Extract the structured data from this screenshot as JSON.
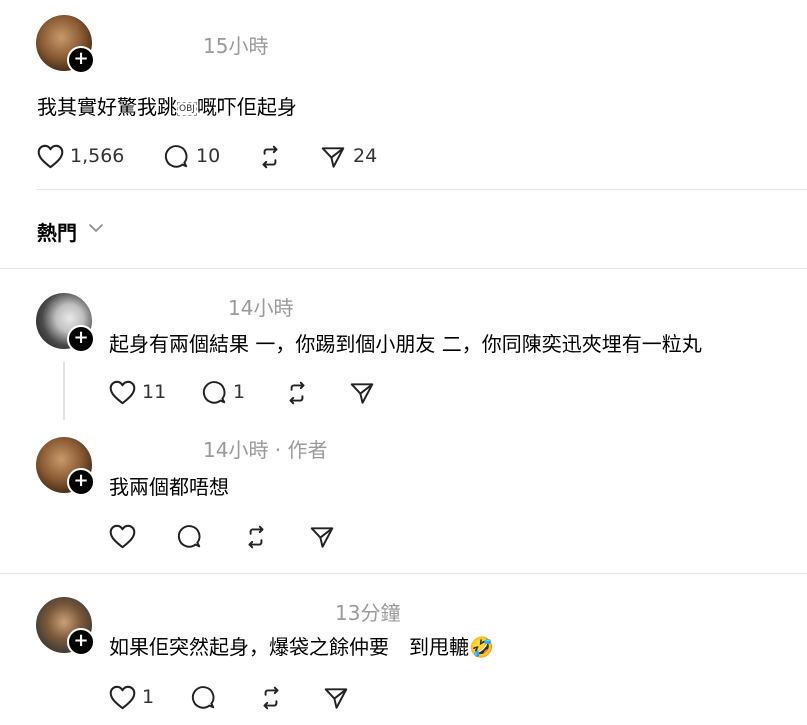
{
  "post": {
    "time": "15小時",
    "text_before": "我其實好驚我跳",
    "obj_glyph": "OBJ",
    "text_after": "嘅吓佢起身",
    "likes": "1,566",
    "comments": "10",
    "shares": "24"
  },
  "sort": {
    "label": "熱門"
  },
  "replies": [
    {
      "time": "14小時",
      "text": "起身有兩個結果 一，你踢到個小朋友 二，你同陳奕迅夾埋有一粒丸",
      "likes": "11",
      "comments": "1"
    },
    {
      "time": "14小時 · 作者",
      "text": "我兩個都唔想"
    },
    {
      "time": "13分鐘",
      "text": "如果佢突然起身，爆袋之餘仲要　到甩轆",
      "emoji": "🤣",
      "likes": "1"
    }
  ],
  "icons": {
    "like": "heart-icon",
    "comment": "comment-icon",
    "repost": "repost-icon",
    "share": "send-icon",
    "follow": "plus-icon",
    "sort": "chevron-down-icon"
  }
}
